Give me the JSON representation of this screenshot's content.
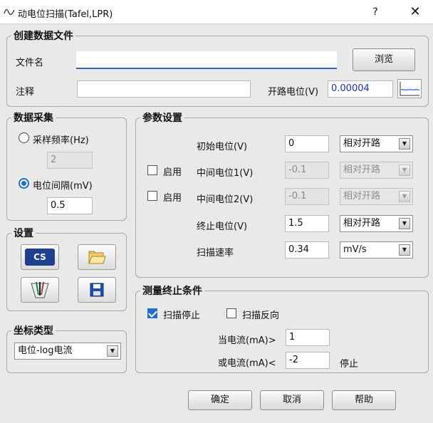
{
  "window": {
    "title": "动电位扫描(Tafel,LPR)",
    "help_label": "?",
    "close_label": "✕"
  },
  "create_file": {
    "legend": "创建数据文件",
    "filename_label": "文件名",
    "filename_value": "",
    "browse_label": "浏览",
    "note_label": "注释",
    "note_value": "",
    "ocp_label": "开路电位(V)",
    "ocp_value": "0.00004"
  },
  "acquisition": {
    "legend": "数据采集",
    "sample_rate_label": "采样频率(Hz)",
    "sample_rate_value": "2",
    "sample_rate_selected": false,
    "interval_label": "电位间隔(mV)",
    "interval_value": "0.5",
    "interval_selected": true
  },
  "settings": {
    "legend": "设置",
    "cs_label": "CS"
  },
  "params": {
    "legend": "参数设置",
    "enable_label": "启用",
    "rows": [
      {
        "label": "初始电位(V)",
        "value": "0",
        "mode": "相对开路",
        "enabled": true,
        "has_checkbox": false
      },
      {
        "label": "中间电位1(V)",
        "value": "-0.1",
        "mode": "相对开路",
        "enabled": false,
        "has_checkbox": true,
        "checked": false
      },
      {
        "label": "中间电位2(V)",
        "value": "-0.1",
        "mode": "相对开路",
        "enabled": false,
        "has_checkbox": true,
        "checked": false
      },
      {
        "label": "终止电位(V)",
        "value": "1.5",
        "mode": "相对开路",
        "enabled": true,
        "has_checkbox": false
      },
      {
        "label": "扫描速率",
        "value": "0.34",
        "mode": "mV/s",
        "enabled": true,
        "has_checkbox": false
      }
    ]
  },
  "coords": {
    "legend": "坐标类型",
    "value": "电位-log电流"
  },
  "termination": {
    "legend": "测量终止条件",
    "scan_stop_label": "扫描停止",
    "scan_stop_checked": true,
    "scan_reverse_label": "扫描反向",
    "scan_reverse_checked": false,
    "current_gt_label": "当电流(mA)>",
    "current_gt_value": "1",
    "current_lt_label": "或电流(mA)<",
    "current_lt_value": "-2",
    "stop_label": "停止"
  },
  "buttons": {
    "ok": "确定",
    "cancel": "取消",
    "help": "帮助"
  },
  "colors": {
    "accent": "#1e6fd1",
    "ocp_value": "#1a2fd0"
  }
}
